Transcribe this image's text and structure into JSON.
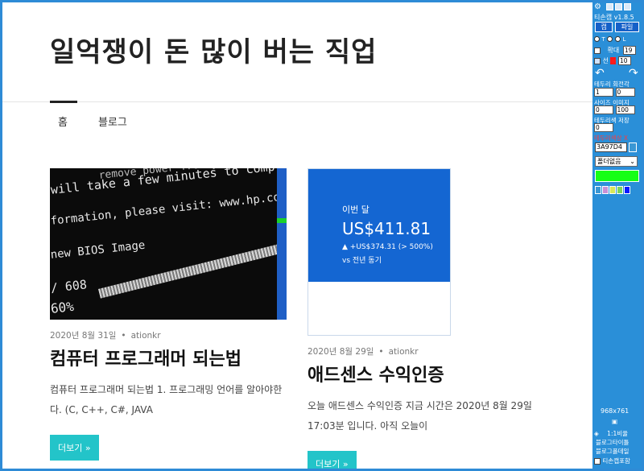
{
  "site": {
    "title": "일억쟁이 돈 많이 버는 직업"
  },
  "nav": {
    "items": [
      "홈",
      "블로그"
    ]
  },
  "posts": [
    {
      "date": "2020년 8월 31일",
      "author": "ationkr",
      "title": "컴퓨터 프로그래머 되는법",
      "excerpt": "컴퓨터 프로그래머 되는법 1. 프로그래밍 언어를 알아야한다. (C, C++, C#, JAVA",
      "more": "더보기 »",
      "thumb_lines": [
        "remove power from your computer during",
        "will take a few minutes to complete.",
        "formation, please visit: www.hp.com/go/techcenter",
        "new BIOS Image",
        "/ 608",
        "60%"
      ]
    },
    {
      "date": "2020년 8월 29일",
      "author": "ationkr",
      "title": "애드센스 수익인증",
      "excerpt": "오늘 애드센스 수익인증 지금 시간은 2020년 8월 29일 17:03분 입니다. 아직 오늘이",
      "more": "더보기 »",
      "card": {
        "label": "이번 달",
        "amount": "US$411.81",
        "change": "▲ +US$374.31 (> 500%)",
        "compare": "vs 전년 동기"
      }
    }
  ],
  "tool": {
    "title": "티손캡 v1.8.5",
    "btn_cap": "캡",
    "btn_file": "파일",
    "radio_labels": [
      "T",
      "L"
    ],
    "zoom_label": "확대",
    "zoom_value": "19",
    "line_label": "선",
    "line_value": "10",
    "labels": [
      "테두리",
      "회전각",
      "사이즈",
      "이미지",
      "테두리색",
      "저장"
    ],
    "border_val": "1",
    "rotate_val": "0",
    "size_val": "0",
    "img_val": "100",
    "save_val": "0",
    "color_label": "테두리색상",
    "color_x": "X",
    "hex": "3A97D4",
    "select_value": "폴더없음",
    "resolution": "968x761",
    "ratio": "1:1비율",
    "open_folder": "블로그타이틀",
    "open_file": "블로그폴데일",
    "always_on": "티손캡포함",
    "colors": {
      "accent": "#2a8fd8",
      "highlight": "#16ff16",
      "swatch": "#3a97d4"
    }
  }
}
